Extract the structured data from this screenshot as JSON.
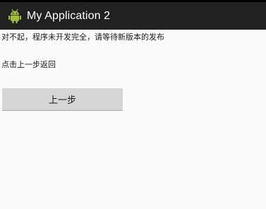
{
  "action_bar": {
    "icon": "android-robot-icon",
    "title": "My Application 2",
    "background": "#212121"
  },
  "main": {
    "message": "对不起，程序未开发完全，请等待新版本的发布",
    "hint": "点击上一步返回",
    "back_button_label": "上一步"
  },
  "colors": {
    "background": "#fbfbfb",
    "android_green": "#9fbf3b",
    "button": "#d6d6d6"
  }
}
